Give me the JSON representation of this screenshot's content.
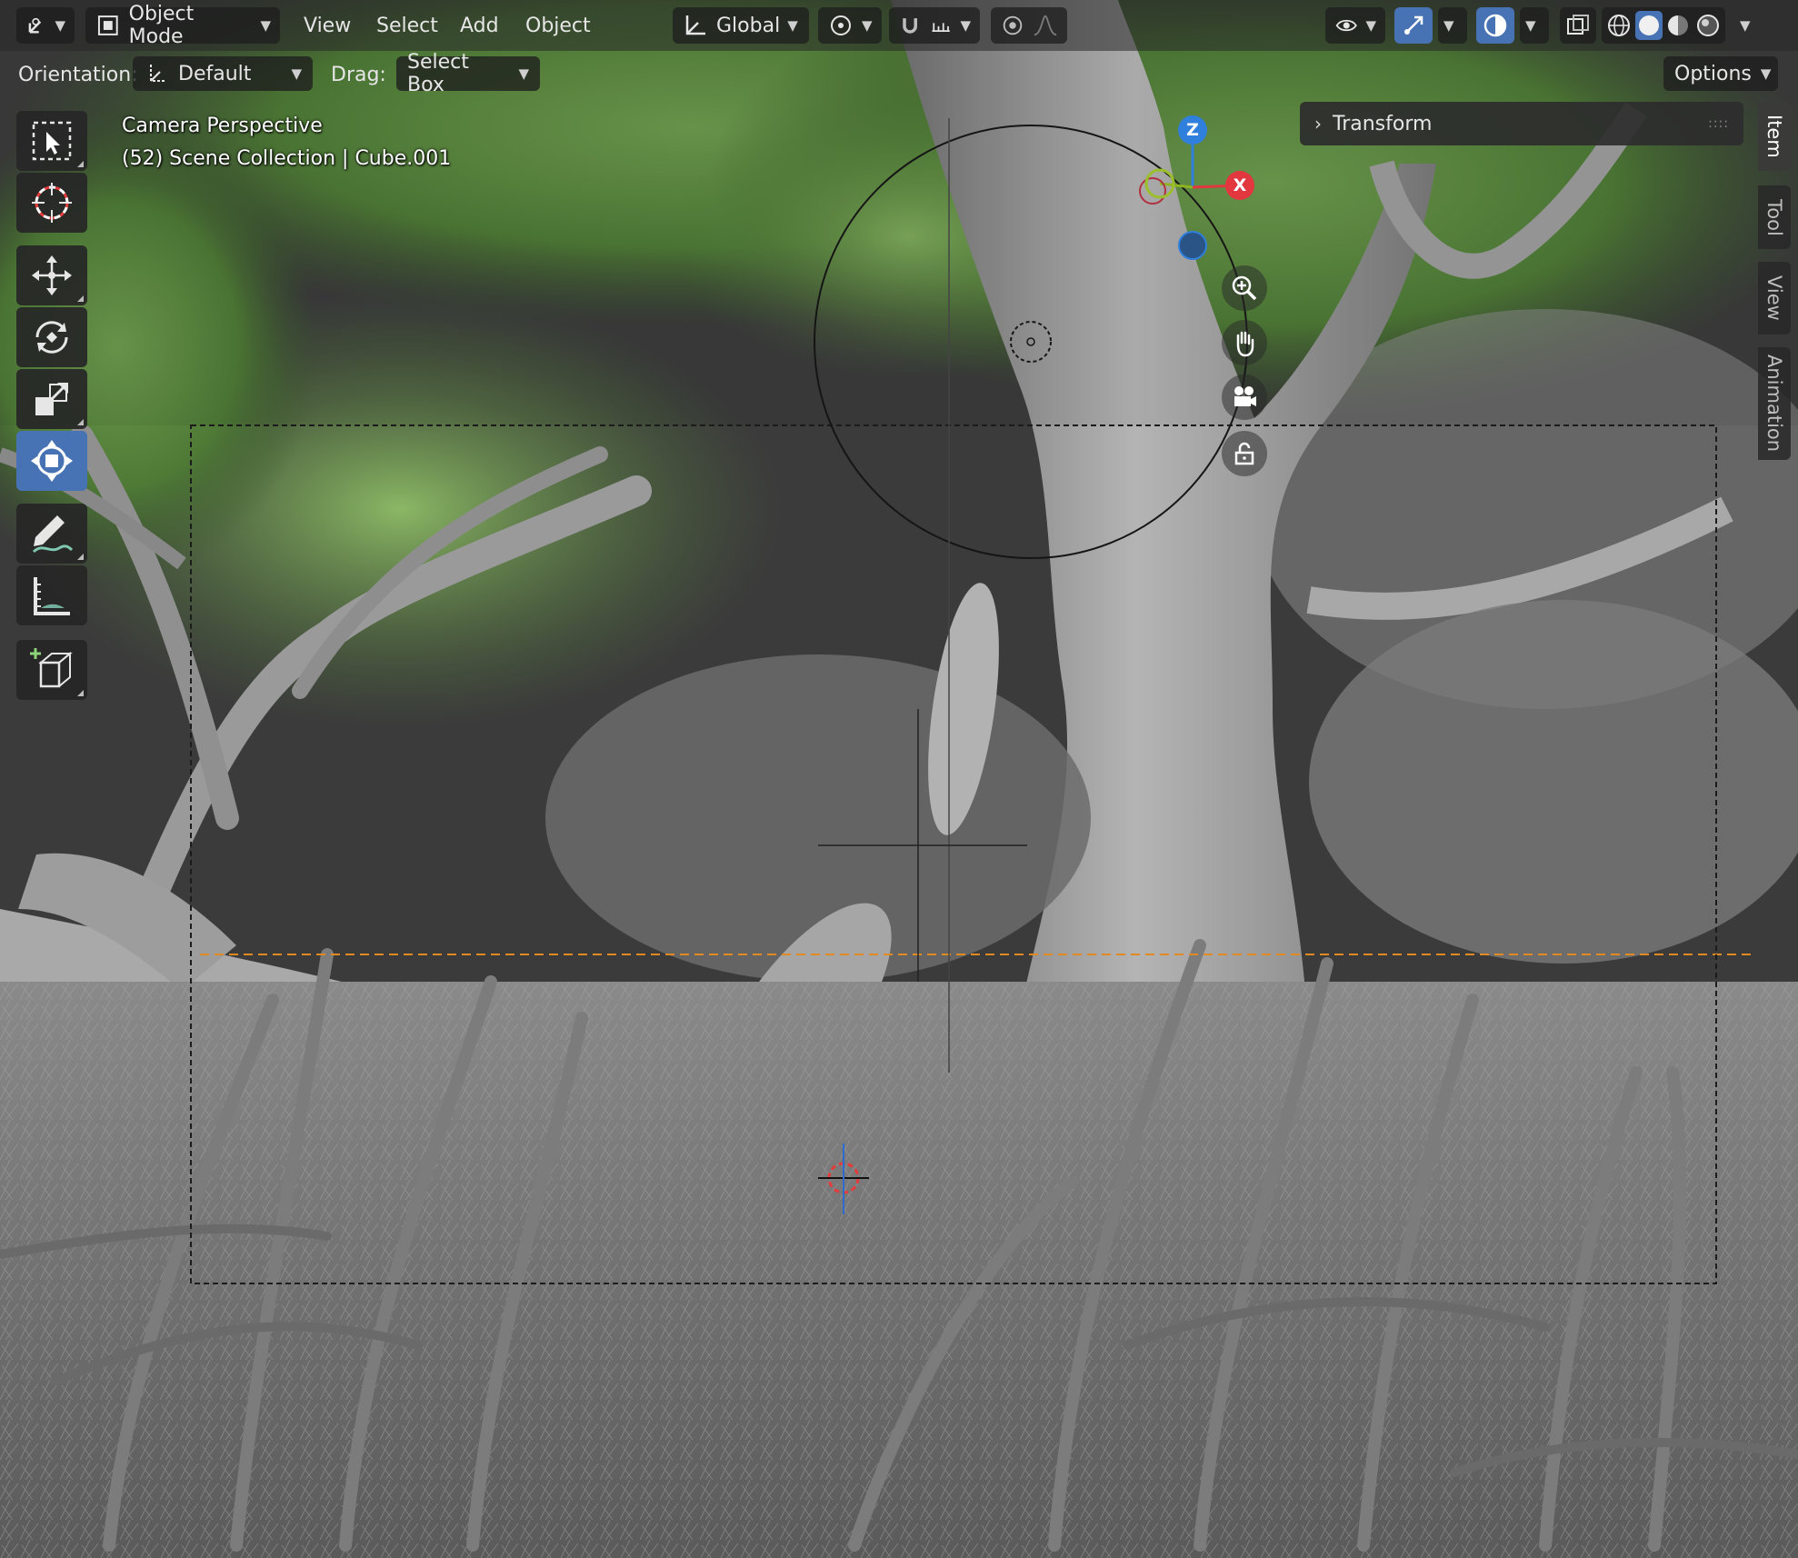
{
  "header": {
    "editor_type_icon": "view3d-icon",
    "mode": {
      "label": "Object Mode",
      "icon": "object-mode-icon"
    },
    "menus": [
      "View",
      "Select",
      "Add",
      "Object"
    ],
    "transform_orientation": {
      "label": "Global",
      "icon": "orientation-global-icon"
    },
    "pivot_icon": "pivot-point-icon",
    "snap_icon": "snap-magnet-icon",
    "snap_increment_icon": "snap-increment-icon",
    "proportional_icon": "proportional-edit-icon",
    "falloff_icon": "falloff-curve-icon",
    "visibility_icon": "eye-icon",
    "gizmo_icon": "gizmo-toggle-icon",
    "overlay_icon": "overlay-icon",
    "xray_icon": "xray-icon",
    "shading_icons": [
      "wireframe-shading-icon",
      "solid-shading-icon",
      "material-shading-icon",
      "rendered-shading-icon"
    ],
    "active_shading_index": 1
  },
  "tool_settings": {
    "orientation_label": "Orientation:",
    "orientation_value": "Default",
    "drag_label": "Drag:",
    "drag_value": "Select Box",
    "options_label": "Options"
  },
  "toolbar": {
    "tools": [
      {
        "name": "select-box-tool",
        "icon": "select-box-icon"
      },
      {
        "name": "cursor-tool",
        "icon": "cursor-icon"
      },
      {
        "name": "move-tool",
        "icon": "move-icon"
      },
      {
        "name": "rotate-tool",
        "icon": "rotate-icon"
      },
      {
        "name": "scale-tool",
        "icon": "scale-icon"
      },
      {
        "name": "transform-tool",
        "icon": "transform-icon",
        "active": true
      },
      {
        "name": "annotate-tool",
        "icon": "annotate-icon"
      },
      {
        "name": "measure-tool",
        "icon": "measure-icon"
      },
      {
        "name": "add-cube-tool",
        "icon": "add-cube-icon"
      }
    ]
  },
  "viewport": {
    "view_name": "Camera Perspective",
    "collection_info": "(52) Scene Collection | Cube.001"
  },
  "gizmo": {
    "z_label": "Z",
    "x_label": "X",
    "z_color": "#2f7fdc",
    "x_color": "#e2373f",
    "y_color": "#8cb320",
    "nav_icons": [
      "zoom-icon",
      "pan-hand-icon",
      "camera-view-icon",
      "lock-icon"
    ]
  },
  "sidebar": {
    "panel_title": "Transform",
    "tabs": [
      "Item",
      "Tool",
      "View",
      "Animation"
    ],
    "active_tab": "Item"
  },
  "colors": {
    "accent": "#4772b3",
    "header_bg": "#2b2b2b",
    "floor_line": "#e28a22"
  }
}
